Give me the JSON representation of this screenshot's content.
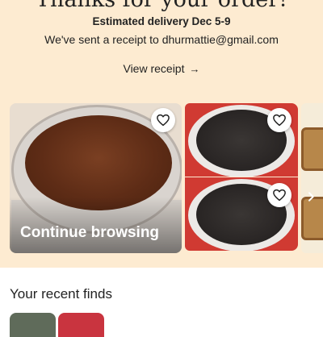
{
  "confirmation": {
    "heading": "Thanks for your order!",
    "estimated_delivery": "Estimated delivery Dec 5-9",
    "receipt_sent": "We've sent a receipt to dhurmattie@gmail.com",
    "view_receipt_label": "View receipt",
    "view_receipt_arrow": "→"
  },
  "continue_browsing": {
    "label": "Continue browsing"
  },
  "recent_finds": {
    "title": "Your recent finds"
  },
  "colors": {
    "banner": "#fdebd1",
    "text": "#222222",
    "card_label": "#ffffff"
  },
  "icons": [
    "heart-icon",
    "arrow-right-icon",
    "chevron-right-icon"
  ]
}
